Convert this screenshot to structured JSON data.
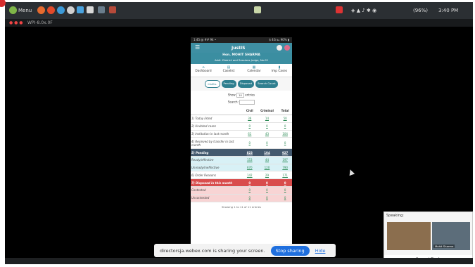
{
  "taskbar": {
    "menu_label": "Menu",
    "battery": "(96%)",
    "time": "3:40 PM",
    "sub_label": "WPI-8.0x.0F"
  },
  "phone": {
    "status_left": "1:45 @ ## 94 •",
    "status_right": "$ 4G ℡ 90% ▮",
    "app_title": "JustIS",
    "user_name": "Hon. MOHIT SHARMA",
    "user_court": "Addl. District and Sessions Judge, No.02",
    "nav": [
      {
        "icon": "dashboard-icon",
        "label": "Dashboard"
      },
      {
        "icon": "caselist-icon",
        "label": "Caselist"
      },
      {
        "icon": "calendar-icon",
        "label": "Calendar"
      },
      {
        "icon": "imp-cases-icon",
        "label": "Imp Cases"
      }
    ],
    "pills": [
      "Institu.",
      "Pending",
      "Disposed",
      "Search Count"
    ],
    "show_label": "Show",
    "show_value": "10",
    "entries_label": "entries",
    "search_label": "Search:",
    "columns": [
      "",
      "Civil",
      "Criminal",
      "Total"
    ],
    "rows": [
      {
        "label": "1) Today listed",
        "civil": "36",
        "criminal": "14",
        "total": "50",
        "style": "normal"
      },
      {
        "label": "2) Undated cases",
        "civil": "0",
        "criminal": "0",
        "total": "0",
        "style": "normal"
      },
      {
        "label": "3) Institution in last month",
        "civil": "61",
        "criminal": "43",
        "total": "104",
        "style": "normal"
      },
      {
        "label": "4) Received by transfer in last month",
        "civil": "0",
        "criminal": "0",
        "total": "0",
        "style": "normal"
      },
      {
        "label": "5) Pending",
        "civil": "823",
        "criminal": "104",
        "total": "927",
        "style": "pend"
      },
      {
        "label": "Ready/effective",
        "civil": "153",
        "criminal": "44",
        "total": "197",
        "style": "sub"
      },
      {
        "label": "Unready/ineffective",
        "civil": "670",
        "criminal": "120",
        "total": "790",
        "style": "sub"
      },
      {
        "label": "6) Order Reasons",
        "civil": "142",
        "criminal": "29",
        "total": "171",
        "style": "normal"
      },
      {
        "label": "7) Disposed in this month",
        "civil": "0",
        "criminal": "0",
        "total": "0",
        "style": "disp"
      },
      {
        "label": "Contested",
        "civil": "0",
        "criminal": "0",
        "total": "0",
        "style": "dsub"
      },
      {
        "label": "Uncontested",
        "civil": "0",
        "criminal": "0",
        "total": "0",
        "style": "dsub"
      }
    ],
    "showing": "Showing 1 to 11 of 11 entries"
  },
  "share_bar": {
    "message": "directorsja.webex.com is sharing your screen.",
    "stop_label": "Stop sharing",
    "hide_label": "Hide"
  },
  "speaking": {
    "header": "Speaking:",
    "participant_tag": "Mohit Sharma",
    "name": "Hemant Singh"
  }
}
